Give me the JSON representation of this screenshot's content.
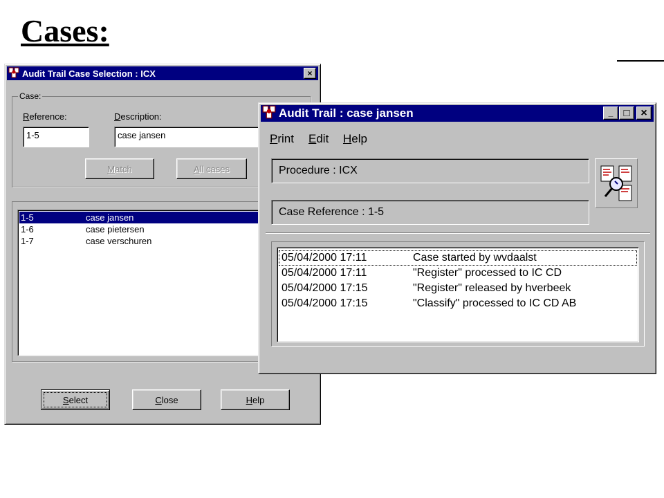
{
  "slide": {
    "title": "Cases:"
  },
  "selection_window": {
    "title": "Audit Trail Case Selection :  ICX",
    "close_glyph": "×",
    "group_label": "Case:",
    "reference_label_first": "R",
    "reference_label_rest": "eference:",
    "reference_value": "1-5",
    "description_label_first": "D",
    "description_label_rest": "escription:",
    "description_value": "case jansen",
    "match_button_first": "M",
    "match_button_rest": "atch",
    "all_cases_button_first": "A",
    "all_cases_button_rest": "ll cases",
    "cases": [
      {
        "reference": "1-5",
        "description": "case jansen",
        "selected": true
      },
      {
        "reference": "1-6",
        "description": "case pietersen",
        "selected": false
      },
      {
        "reference": "1-7",
        "description": "case verschuren",
        "selected": false
      }
    ],
    "select_button_first": "S",
    "select_button_rest": "elect",
    "close_button_first": "C",
    "close_button_rest": "lose",
    "help_button_first": "H",
    "help_button_rest": "elp"
  },
  "audit_window": {
    "title": "Audit Trail :  case jansen",
    "minimize_glyph": "_",
    "maximize_glyph": "□",
    "close_glyph": "×",
    "menu": [
      {
        "first": "P",
        "rest": "rint"
      },
      {
        "first": "E",
        "rest": "dit"
      },
      {
        "first": "H",
        "rest": "elp"
      }
    ],
    "procedure_text": "Procedure :  ICX",
    "case_reference_text": "Case Reference : 1-5",
    "entries": [
      {
        "timestamp": "05/04/2000 17:11",
        "event": "Case started by wvdaalst"
      },
      {
        "timestamp": "05/04/2000 17:11",
        "event": "\"Register\" processed to IC CD"
      },
      {
        "timestamp": "05/04/2000 17:15",
        "event": "\"Register\" released by hverbeek"
      },
      {
        "timestamp": "05/04/2000 17:15",
        "event": "\"Classify\" processed to IC CD AB"
      }
    ]
  },
  "icons": {
    "app": "audit-trail-app-icon",
    "audit_trail": "document-magnifier-icon"
  },
  "colors": {
    "title_bar": "#000080",
    "window_face": "#c0c0c0",
    "selection": "#000080"
  }
}
